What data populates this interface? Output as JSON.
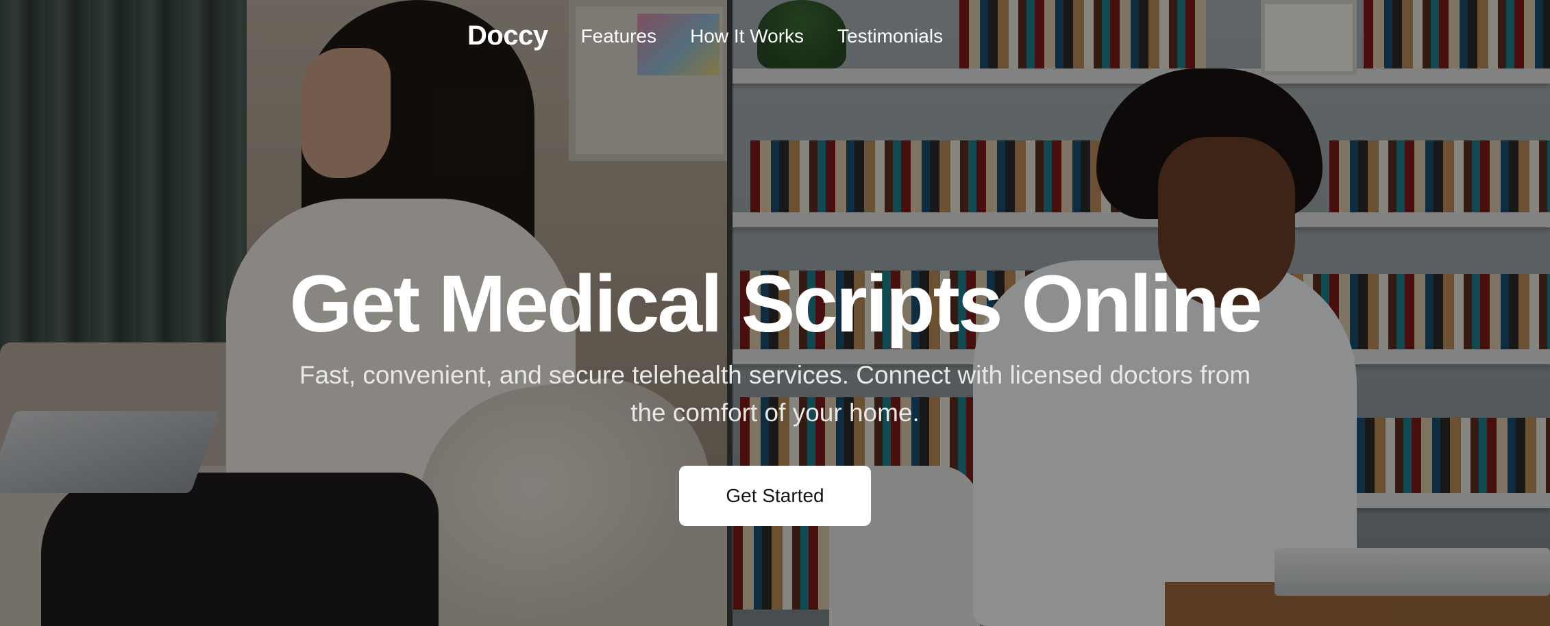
{
  "nav": {
    "brand": "Doccy",
    "links": [
      "Features",
      "How It Works",
      "Testimonials"
    ]
  },
  "hero": {
    "headline": "Get Medical Scripts Online",
    "subtitle": "Fast, convenient, and secure telehealth services. Connect with licensed doctors from the comfort of your home.",
    "cta_label": "Get Started"
  },
  "colors": {
    "text": "#ffffff",
    "button_bg": "#ffffff",
    "button_text": "#111111",
    "overlay": "rgba(0,0,0,0.42)"
  }
}
